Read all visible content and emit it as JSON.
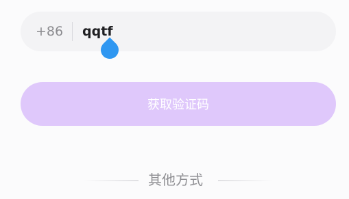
{
  "login": {
    "country_code": "+86",
    "phone_value": "qqtf",
    "get_code_label": "获取验证码",
    "other_methods_label": "其他方式"
  },
  "colors": {
    "input_background": "#f3f3f5",
    "button_background": "#dfc8fb",
    "caret_color": "#2f97f1"
  },
  "icons": {
    "text_caret_handle": "teardrop-caret-handle"
  }
}
